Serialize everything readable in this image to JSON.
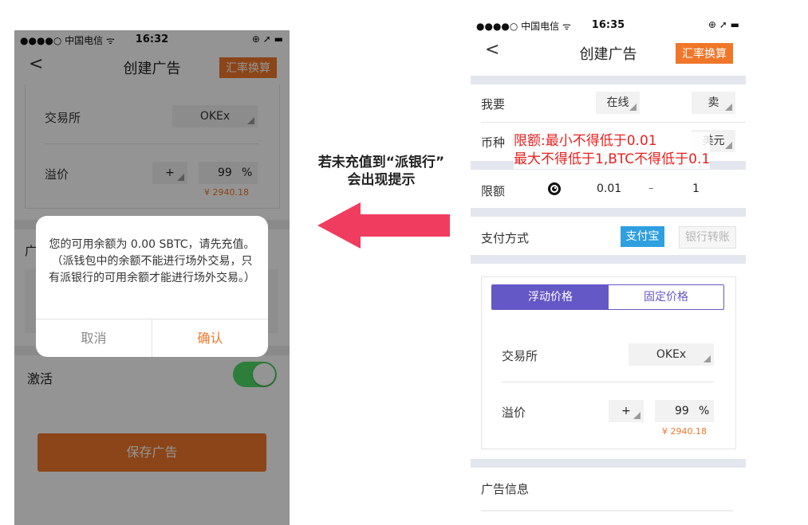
{
  "left": {
    "status": {
      "carrier": "●●●●○ 中国电信 ᯤ",
      "time": "16:32",
      "right": "⊕ ➚ ▬"
    },
    "nav": {
      "back": "<",
      "title": "创建广告",
      "rate_btn": "汇率换算"
    },
    "exchange_label": "交易所",
    "exchange_value": "OKEx",
    "premium_label": "溢价",
    "premium_sign": "+",
    "premium_value": "99",
    "premium_unit": "%",
    "premium_price": "¥ 2940.18",
    "ad_label_fragment": "广",
    "activate_label": "激活",
    "save_btn": "保存广告",
    "dialog": {
      "message": "您的可用余额为 0.00 SBTC，请先充值。（派钱包中的余额不能进行场外交易，只有派银行的可用余额才能进行场外交易。）",
      "cancel": "取消",
      "confirm": "确认"
    }
  },
  "annotation": {
    "line1": "若未充值到“派银行”",
    "line2": "会出现提示"
  },
  "right": {
    "status": {
      "carrier": "●●●●○ 中国电信 ᯤ",
      "time": "16:35",
      "right": "⊕ ➚ ▬"
    },
    "nav": {
      "back": "<",
      "title": "创建广告",
      "rate_btn": "汇率换算"
    },
    "want_label": "我要",
    "want_mode": "在线",
    "want_side": "卖",
    "currency_label": "币种",
    "currency_value": "美元",
    "limit_note_1": "限额:最小不得低于0.01",
    "limit_note_2": "最大不得低于1,BTC不得低于0.1",
    "limit_label": "限额",
    "limit_min": "0.01",
    "limit_dash": "–",
    "limit_max": "1",
    "pay_label": "支付方式",
    "pay_alipay": "支付宝",
    "pay_bank": "银行转账",
    "tab_float": "浮动价格",
    "tab_fixed": "固定价格",
    "exchange_label": "交易所",
    "exchange_value": "OKEx",
    "premium_label": "溢价",
    "premium_sign": "+",
    "premium_value": "99",
    "premium_unit": "%",
    "premium_price": "¥ 2940.18",
    "ad_info_label": "广告信息"
  },
  "colors": {
    "accent": "#f0772a",
    "purple": "#6457c6",
    "blue": "#2f9fe0",
    "red": "#e8211f",
    "arrow": "#f03d5f"
  }
}
